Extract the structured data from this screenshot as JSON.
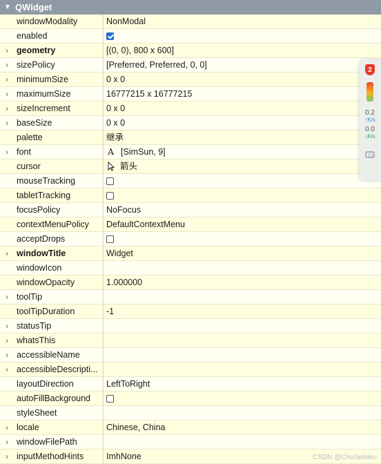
{
  "header": {
    "title": "QWidget"
  },
  "rows": [
    {
      "name": "windowModality",
      "value": "NonModal",
      "expandable": false,
      "bold": false
    },
    {
      "name": "enabled",
      "value": "",
      "checkbox": "checked",
      "expandable": false,
      "bold": false
    },
    {
      "name": "geometry",
      "value": "[(0, 0), 800 x 600]",
      "expandable": true,
      "bold": true
    },
    {
      "name": "sizePolicy",
      "value": "[Preferred, Preferred, 0, 0]",
      "expandable": true,
      "bold": false
    },
    {
      "name": "minimumSize",
      "value": "0 x 0",
      "expandable": true,
      "bold": false
    },
    {
      "name": "maximumSize",
      "value": "16777215 x 16777215",
      "expandable": true,
      "bold": false
    },
    {
      "name": "sizeIncrement",
      "value": "0 x 0",
      "expandable": true,
      "bold": false
    },
    {
      "name": "baseSize",
      "value": "0 x 0",
      "expandable": true,
      "bold": false
    },
    {
      "name": "palette",
      "value": "继承",
      "expandable": false,
      "bold": false
    },
    {
      "name": "font",
      "value": "[SimSun, 9]",
      "glyph": "A",
      "expandable": true,
      "bold": false
    },
    {
      "name": "cursor",
      "value": "箭头",
      "cursor": true,
      "expandable": false,
      "bold": false
    },
    {
      "name": "mouseTracking",
      "value": "",
      "checkbox": "unchecked",
      "expandable": false,
      "bold": false
    },
    {
      "name": "tabletTracking",
      "value": "",
      "checkbox": "unchecked",
      "expandable": false,
      "bold": false
    },
    {
      "name": "focusPolicy",
      "value": "NoFocus",
      "expandable": false,
      "bold": false
    },
    {
      "name": "contextMenuPolicy",
      "value": "DefaultContextMenu",
      "expandable": false,
      "bold": false
    },
    {
      "name": "acceptDrops",
      "value": "",
      "checkbox": "unchecked",
      "expandable": false,
      "bold": false
    },
    {
      "name": "windowTitle",
      "value": "Widget",
      "expandable": true,
      "bold": true
    },
    {
      "name": "windowIcon",
      "value": "",
      "expandable": false,
      "bold": false
    },
    {
      "name": "windowOpacity",
      "value": "1.000000",
      "expandable": false,
      "bold": false
    },
    {
      "name": "toolTip",
      "value": "",
      "expandable": true,
      "bold": false
    },
    {
      "name": "toolTipDuration",
      "value": "-1",
      "expandable": false,
      "bold": false
    },
    {
      "name": "statusTip",
      "value": "",
      "expandable": true,
      "bold": false
    },
    {
      "name": "whatsThis",
      "value": "",
      "expandable": true,
      "bold": false
    },
    {
      "name": "accessibleName",
      "value": "",
      "expandable": true,
      "bold": false
    },
    {
      "name": "accessibleDescripti...",
      "value": "",
      "expandable": true,
      "bold": false
    },
    {
      "name": "layoutDirection",
      "value": "LeftToRight",
      "expandable": false,
      "bold": false
    },
    {
      "name": "autoFillBackground",
      "value": "",
      "checkbox": "unchecked",
      "expandable": false,
      "bold": false
    },
    {
      "name": "styleSheet",
      "value": "",
      "expandable": false,
      "bold": false
    },
    {
      "name": "locale",
      "value": "Chinese, China",
      "expandable": true,
      "bold": false
    },
    {
      "name": "windowFilePath",
      "value": "",
      "expandable": true,
      "bold": false
    },
    {
      "name": "inputMethodHints",
      "value": "ImhNone",
      "expandable": true,
      "bold": false
    }
  ],
  "side_widget": {
    "badge": "2",
    "upload_speed": "0.2",
    "upload_unit": "K/s",
    "download_speed": "0.0",
    "download_unit": "K/s"
  },
  "watermark": "CSDN @ChoSeitaku",
  "colors": {
    "header_bg": "#8f9aa6",
    "row_bg": "#ffffdf",
    "row_alt_bg": "#fffff2",
    "checkbox_checked": "#1f6fd1"
  }
}
